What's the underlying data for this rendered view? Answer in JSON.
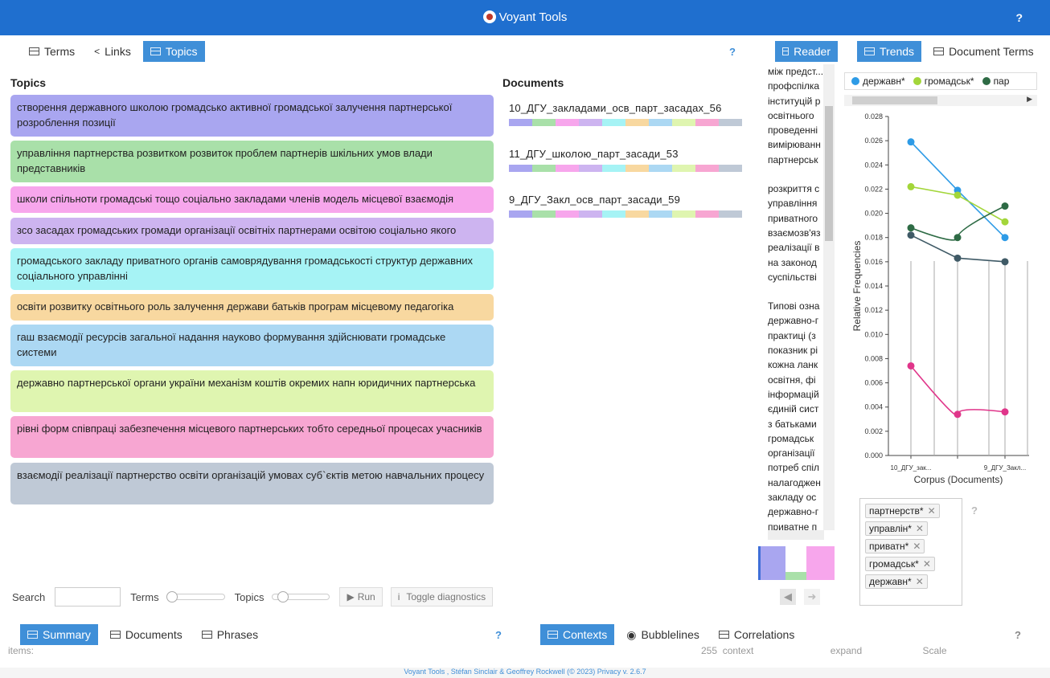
{
  "app": {
    "title": "Voyant Tools",
    "help": "?"
  },
  "left_tabs": [
    "Terms",
    "Links",
    "Topics"
  ],
  "mid_tabs": [
    "Reader"
  ],
  "right_tabs": [
    "Trends",
    "Document Terms"
  ],
  "help_mark": "?",
  "topics": {
    "heading": "Topics",
    "items": [
      {
        "text": "створення державного школою громадсько активної громадської залучення партнерської розроблення позиції",
        "color": "#a9a6f0"
      },
      {
        "text": "управління партнерства розвитком розвиток проблем партнерів шкільних умов влади представників",
        "color": "#a9e0a9"
      },
      {
        "text": "школи спільноти громадські тощо соціально закладами членів модель місцевої взаємодія",
        "color": "#f7a6ec"
      },
      {
        "text": "зсо засадах громадських громади організації освітніх партнерами освітою соціально якого",
        "color": "#cdb4f0"
      },
      {
        "text": "громадського закладу приватного органів самоврядування громадськості структур державних соціального управлінні",
        "color": "#a6f3f5"
      },
      {
        "text": "освіти розвитку освітнього роль залучення держави батьків програм місцевому педагогіка",
        "color": "#f8d8a0"
      },
      {
        "text": "гаш взаємодії ресурсів загальної надання науково формування здійснювати громадське системи",
        "color": "#acd8f3"
      },
      {
        "text": "державно партнерської органи україни механізм коштів окремих напн юридичних партнерська",
        "color": "#dff5b0"
      },
      {
        "text": "рівні форм співпраці забезпечення місцевого партнерських тобто середньої процесах учасників",
        "color": "#f7a6d2"
      },
      {
        "text": "взаємодії реалізації партнерство освіти організацій умовах суб`єктів метою навчальних процесу",
        "color": "#bfc9d6"
      }
    ]
  },
  "documents": {
    "heading": "Documents",
    "items": [
      {
        "title": "10_ДГУ_закладами_осв_парт_засадах_56"
      },
      {
        "title": "11_ДГУ_школою_парт_засади_53"
      },
      {
        "title": "9_ДГУ_Закл_осв_парт_засади_59"
      }
    ]
  },
  "reader": {
    "paragraphs": [
      [
        "між предст...",
        "профспілка",
        "інституцій р",
        "освітнього",
        "проведенні",
        "вимірюванн",
        "партнерськ"
      ],
      [
        "розкриття с",
        "управління",
        "приватного",
        "взаємозв'яз",
        "реалізації в",
        "на законод",
        "суспільстві"
      ],
      [
        "Типові озна",
        "державно-г",
        "практиці (з",
        "показник рі",
        "кожна ланк",
        "освітня, фі",
        "інформацій",
        "єдиній сист",
        "з батьками",
        "громадськ",
        "організації",
        "потреб спіл",
        "налагоджен",
        "закладу ос",
        "державно-г",
        "приватне п"
      ]
    ]
  },
  "trends": {
    "legend": [
      {
        "label": "державн*",
        "color": "#2e9be6"
      },
      {
        "label": "громадськ*",
        "color": "#a3d63a"
      },
      {
        "label": "пар",
        "color": "#2e6b45"
      }
    ],
    "terms": [
      "партнерств*",
      "управлін*",
      "приватн*",
      "громадськ*",
      "державн*"
    ],
    "remove_glyph": "✕"
  },
  "chart_data": {
    "type": "line",
    "xlabel": "Corpus (Documents)",
    "ylabel": "Relative Frequencies",
    "ylim": [
      0,
      0.028
    ],
    "yticks": [
      "0.000",
      "0.002",
      "0.004",
      "0.006",
      "0.008",
      "0.010",
      "0.012",
      "0.014",
      "0.016",
      "0.018",
      "0.020",
      "0.022",
      "0.024",
      "0.026",
      "0.028"
    ],
    "categories": [
      "10_ДГУ_зак...",
      "",
      "9_ДГУ_Закл..."
    ],
    "series": [
      {
        "name": "державн*",
        "color": "#2e9be6",
        "values": [
          0.0259,
          0.0219,
          0.018
        ]
      },
      {
        "name": "громадськ*",
        "color": "#a3d63a",
        "values": [
          0.0222,
          0.0215,
          0.0193
        ]
      },
      {
        "color": "#2e6b45",
        "values": [
          0.0188,
          0.018,
          0.0206
        ]
      },
      {
        "color": "#3f5a66",
        "values": [
          0.0182,
          0.0163,
          0.016
        ]
      },
      {
        "color": "#e0358a",
        "values": [
          0.0074,
          0.0034,
          0.0036
        ]
      }
    ]
  },
  "controls": {
    "search_label": "Search",
    "terms_label": "Terms",
    "topics_label": "Topics",
    "run_label": "Run",
    "toggle_label": "Toggle diagnostics"
  },
  "bottom_tabs_left": [
    "Summary",
    "Documents",
    "Phrases"
  ],
  "bottom_tabs_right": [
    "Contexts",
    "Bubblelines",
    "Correlations"
  ],
  "bottom_peek": {
    "items": "items:",
    "num": "255",
    "context": "context",
    "expand": "expand",
    "scale": "Scale"
  },
  "footer": "Voyant Tools , Stéfan Sinclair & Geoffrey Rockwell (© 2023) Privacy v. 2.6.7"
}
